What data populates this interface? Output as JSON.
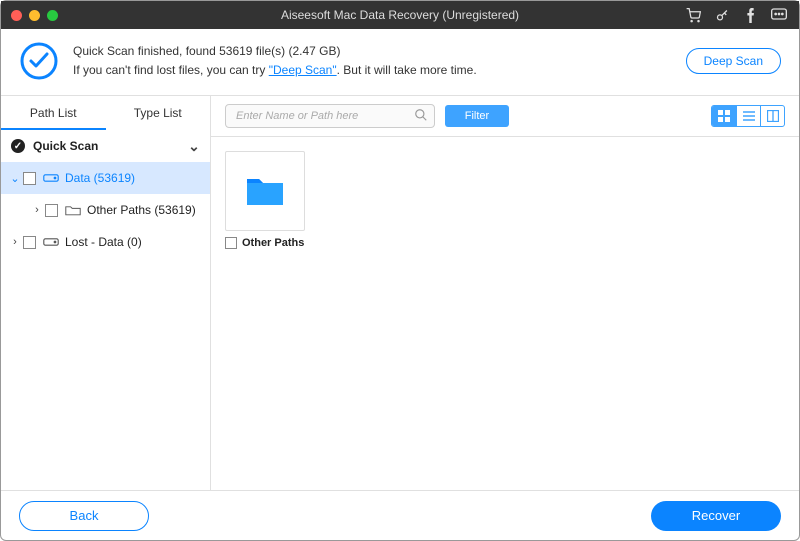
{
  "window": {
    "title": "Aiseesoft Mac Data Recovery (Unregistered)"
  },
  "status": {
    "line1_prefix": "Quick Scan finished, found ",
    "file_count": "53619",
    "line1_mid": " file(s) ",
    "size": "(2.47 GB)",
    "line2_prefix": "If you can't find lost files, you can try ",
    "deep_link": "\"Deep Scan\"",
    "line2_suffix": ". But it will take more time.",
    "deep_scan_btn": "Deep Scan"
  },
  "tabs": {
    "path": "Path List",
    "type": "Type List"
  },
  "tree": {
    "quick_scan": "Quick Scan",
    "data": "Data (53619)",
    "other_paths": "Other Paths (53619)",
    "lost_data": "Lost - Data (0)"
  },
  "toolbar": {
    "search_placeholder": "Enter Name or Path here",
    "filter": "Filter"
  },
  "content": {
    "item0": {
      "label": "Other Paths"
    }
  },
  "footer": {
    "back": "Back",
    "recover": "Recover"
  }
}
